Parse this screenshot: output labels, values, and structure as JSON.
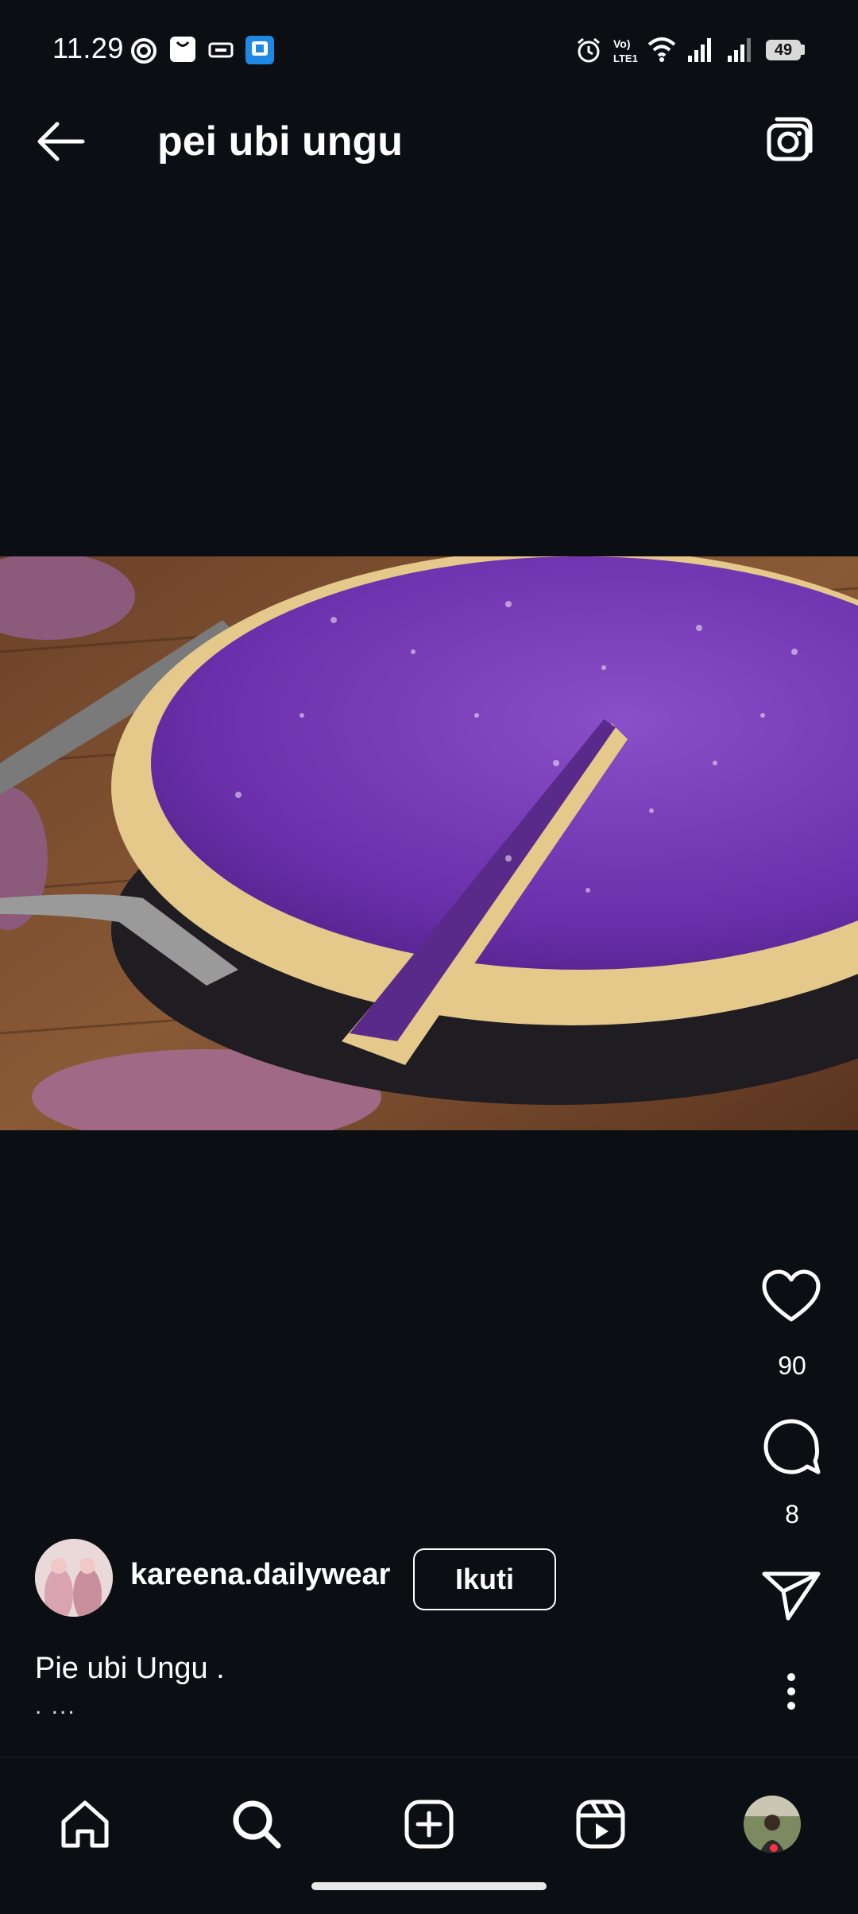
{
  "status_bar": {
    "time": "11.29",
    "battery": "49",
    "icons": [
      "signal-circle-icon",
      "bag-icon",
      "card-icon",
      "app-store-icon",
      "alarm-icon",
      "volte-icon",
      "wifi-icon",
      "signal-icon",
      "signal-icon-2",
      "battery-icon"
    ]
  },
  "header": {
    "title": "pei ubi ungu",
    "back_icon": "arrow-left-icon",
    "camera_icon": "camera-icon"
  },
  "post": {
    "image_subject": "purple sweet potato pie",
    "likes": "90",
    "comments": "8",
    "username": "kareena.dailywear",
    "follow_label": "Ikuti",
    "caption": "Pie ubi Ungu .",
    "caption_more": ". ..."
  },
  "nav": {
    "items": [
      "home-icon",
      "search-icon",
      "add-post-icon",
      "reels-icon",
      "profile-avatar"
    ]
  },
  "colors": {
    "background": "#0b0e12",
    "accent_dot": "#ff3040"
  }
}
